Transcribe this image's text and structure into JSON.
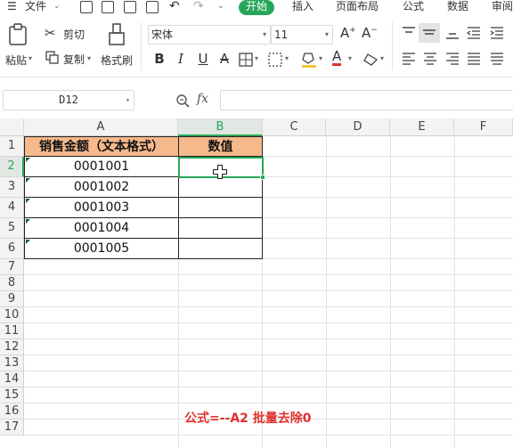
{
  "menu": {
    "hamburger_label": "文件",
    "tabs": [
      "开始",
      "插入",
      "页面布局",
      "公式",
      "数据",
      "审阅"
    ]
  },
  "ribbon": {
    "paste": "粘贴",
    "cut": "剪切",
    "copy": "复制",
    "format_painter": "格式刷",
    "font_name": "宋体",
    "font_size": "11",
    "bold": "B",
    "italic": "I",
    "underline": "U",
    "increase_font": "A+",
    "decrease_font": "A-"
  },
  "formula_bar": {
    "name_box": "D12",
    "fx": "fx",
    "formula": ""
  },
  "sheet": {
    "columns": [
      "A",
      "B",
      "C",
      "D",
      "E",
      "F"
    ],
    "rows": [
      "1",
      "2",
      "3",
      "4",
      "5",
      "6",
      "7",
      "8",
      "9",
      "10",
      "11",
      "12",
      "13",
      "14",
      "15",
      "16",
      "17"
    ],
    "header_row": {
      "A": "销售金额（文本格式）",
      "B": "数值"
    },
    "data": [
      {
        "A": "0001001",
        "B": ""
      },
      {
        "A": "0001002",
        "B": ""
      },
      {
        "A": "0001003",
        "B": ""
      },
      {
        "A": "0001004",
        "B": ""
      },
      {
        "A": "0001005",
        "B": ""
      }
    ],
    "selected_cell": "B2",
    "selected_column": "B",
    "selected_row": "2"
  },
  "annotation": "公式=--A2 批量去除0",
  "colors": {
    "accent": "#27a65a",
    "header_fill": "#f6b98b",
    "annotation": "#e0322d"
  }
}
